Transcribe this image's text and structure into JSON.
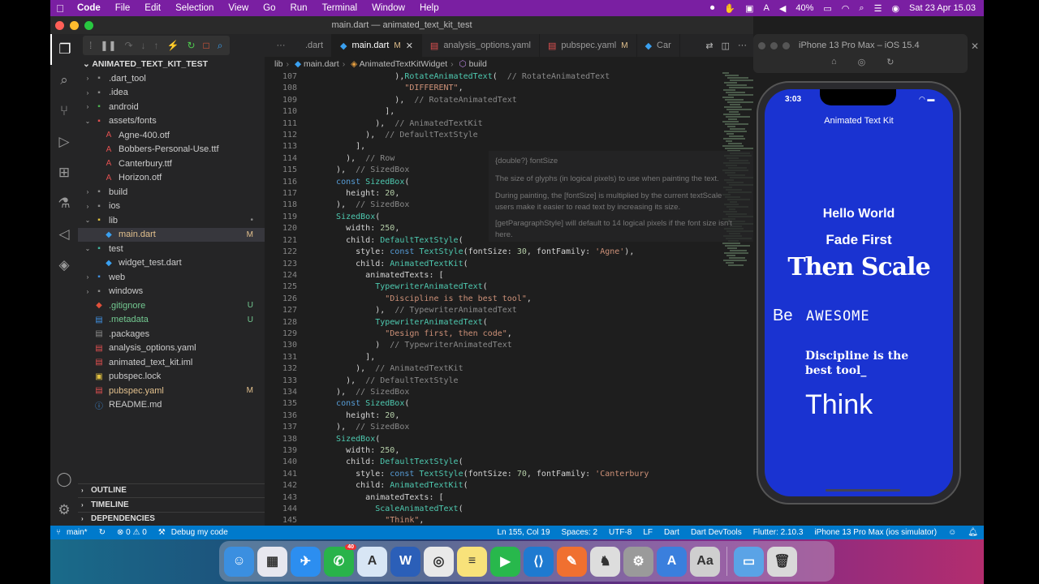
{
  "menubar": {
    "app": "Code",
    "items": [
      "File",
      "Edit",
      "Selection",
      "View",
      "Go",
      "Run",
      "Terminal",
      "Window",
      "Help"
    ],
    "battery": "40%",
    "datetime": "Sat 23 Apr  15.03"
  },
  "window": {
    "title": "main.dart — animated_text_kit_test"
  },
  "sidebar": {
    "root": "ANIMATED_TEXT_KIT_TEST",
    "items": [
      {
        "label": ".dart_tool",
        "indent": 1,
        "type": "folder",
        "chev": "›",
        "badge": ""
      },
      {
        "label": ".idea",
        "indent": 1,
        "type": "folder",
        "chev": "›",
        "badge": ""
      },
      {
        "label": "android",
        "indent": 1,
        "type": "folder-green",
        "chev": "›",
        "badge": ""
      },
      {
        "label": "assets/fonts",
        "indent": 1,
        "type": "folder-red",
        "chev": "⌄",
        "badge": ""
      },
      {
        "label": "Agne-400.otf",
        "indent": 2,
        "type": "font",
        "chev": "",
        "badge": ""
      },
      {
        "label": "Bobbers-Personal-Use.ttf",
        "indent": 2,
        "type": "font",
        "chev": "",
        "badge": ""
      },
      {
        "label": "Canterbury.ttf",
        "indent": 2,
        "type": "font",
        "chev": "",
        "badge": ""
      },
      {
        "label": "Horizon.otf",
        "indent": 2,
        "type": "font",
        "chev": "",
        "badge": ""
      },
      {
        "label": "build",
        "indent": 1,
        "type": "folder",
        "chev": "›",
        "badge": ""
      },
      {
        "label": "ios",
        "indent": 1,
        "type": "folder",
        "chev": "›",
        "badge": ""
      },
      {
        "label": "lib",
        "indent": 1,
        "type": "folder-yellow",
        "chev": "⌄",
        "badge": "•"
      },
      {
        "label": "main.dart",
        "indent": 2,
        "type": "dart",
        "chev": "",
        "badge": "M",
        "selected": true
      },
      {
        "label": "test",
        "indent": 1,
        "type": "folder-teal",
        "chev": "⌄",
        "badge": ""
      },
      {
        "label": "widget_test.dart",
        "indent": 2,
        "type": "dart",
        "chev": "",
        "badge": ""
      },
      {
        "label": "web",
        "indent": 1,
        "type": "folder-blue",
        "chev": "›",
        "badge": ""
      },
      {
        "label": "windows",
        "indent": 1,
        "type": "folder",
        "chev": "›",
        "badge": ""
      },
      {
        "label": ".gitignore",
        "indent": 1,
        "type": "git",
        "chev": "",
        "badge": "U"
      },
      {
        "label": ".metadata",
        "indent": 1,
        "type": "file-blue",
        "chev": "",
        "badge": "U"
      },
      {
        "label": ".packages",
        "indent": 1,
        "type": "file",
        "chev": "",
        "badge": ""
      },
      {
        "label": "analysis_options.yaml",
        "indent": 1,
        "type": "yaml",
        "chev": "",
        "badge": ""
      },
      {
        "label": "animated_text_kit.iml",
        "indent": 1,
        "type": "iml",
        "chev": "",
        "badge": ""
      },
      {
        "label": "pubspec.lock",
        "indent": 1,
        "type": "lock",
        "chev": "",
        "badge": ""
      },
      {
        "label": "pubspec.yaml",
        "indent": 1,
        "type": "yaml",
        "chev": "",
        "badge": "M"
      },
      {
        "label": "README.md",
        "indent": 1,
        "type": "md",
        "chev": "",
        "badge": ""
      }
    ],
    "sections": [
      "OUTLINE",
      "TIMELINE",
      "DEPENDENCIES"
    ]
  },
  "tabs": [
    {
      "label": ".dart",
      "modified": "",
      "active": false,
      "icon": ""
    },
    {
      "label": "main.dart",
      "modified": "M",
      "active": true,
      "icon": "dart"
    },
    {
      "label": "analysis_options.yaml",
      "modified": "",
      "active": false,
      "icon": "yaml"
    },
    {
      "label": "pubspec.yaml",
      "modified": "M",
      "active": false,
      "icon": "yaml"
    },
    {
      "label": "Car",
      "modified": "",
      "active": false,
      "icon": "dart"
    }
  ],
  "breadcrumb": [
    "lib",
    "main.dart",
    "AnimatedTextKitWidget",
    "build"
  ],
  "hover": {
    "sig": "{double?} fontSize",
    "lines": [
      "The size of glyphs (in logical pixels) to use when painting the text.",
      "During painting, the [fontSize] is multiplied by the current textScale",
      "users make it easier to read text by increasing its size.",
      "[getParagraphStyle] will default to 14 logical pixels if the font size isn't",
      "here."
    ]
  },
  "code_start": 107,
  "code": [
    [
      [
        16,
        ""
      ],
      [
        "p",
        "),"
      ],
      [
        "c",
        "RotateAnimatedText"
      ],
      [
        "p",
        "(  "
      ],
      [
        "cmt",
        "// RotateAnimatedText"
      ]
    ],
    [
      [
        17,
        ""
      ],
      [
        "s",
        "\"DIFFERENT\""
      ],
      [
        "p",
        ","
      ]
    ],
    [
      [
        16,
        ""
      ],
      [
        "p",
        "),  "
      ],
      [
        "cmt",
        "// RotateAnimatedText"
      ]
    ],
    [
      [
        15,
        ""
      ],
      [
        "p",
        "],"
      ]
    ],
    [
      [
        14,
        ""
      ],
      [
        "p",
        "),  "
      ],
      [
        "cmt",
        "// AnimatedTextKit"
      ]
    ],
    [
      [
        13,
        ""
      ],
      [
        "p",
        "),  "
      ],
      [
        "cmt",
        "// DefaultTextStyle"
      ]
    ],
    [
      [
        12,
        ""
      ],
      [
        "p",
        "],"
      ]
    ],
    [
      [
        11,
        ""
      ],
      [
        "p",
        "),  "
      ],
      [
        "cmt",
        "// Row"
      ]
    ],
    [
      [
        10,
        ""
      ],
      [
        "p",
        "),  "
      ],
      [
        "cmt",
        "// SizedBox"
      ]
    ],
    [
      [
        10,
        ""
      ],
      [
        "k",
        "const "
      ],
      [
        "c",
        "SizedBox"
      ],
      [
        "p",
        "("
      ]
    ],
    [
      [
        11,
        ""
      ],
      [
        "p",
        "height: "
      ],
      [
        "n",
        "20"
      ],
      [
        "p",
        ","
      ]
    ],
    [
      [
        10,
        ""
      ],
      [
        "p",
        "),  "
      ],
      [
        "cmt",
        "// SizedBox"
      ]
    ],
    [
      [
        10,
        ""
      ],
      [
        "c",
        "SizedBox"
      ],
      [
        "p",
        "("
      ]
    ],
    [
      [
        11,
        ""
      ],
      [
        "p",
        "width: "
      ],
      [
        "n",
        "250"
      ],
      [
        "p",
        ","
      ]
    ],
    [
      [
        11,
        ""
      ],
      [
        "p",
        "child: "
      ],
      [
        "c",
        "DefaultTextStyle"
      ],
      [
        "p",
        "("
      ]
    ],
    [
      [
        12,
        ""
      ],
      [
        "p",
        "style: "
      ],
      [
        "k",
        "const "
      ],
      [
        "c",
        "TextStyle"
      ],
      [
        "p",
        "(fontSize: "
      ],
      [
        "n",
        "30"
      ],
      [
        "p",
        ", fontFamily: "
      ],
      [
        "s",
        "'Agne'"
      ],
      [
        "p",
        "),"
      ]
    ],
    [
      [
        12,
        ""
      ],
      [
        "p",
        "child: "
      ],
      [
        "c",
        "AnimatedTextKit"
      ],
      [
        "p",
        "("
      ]
    ],
    [
      [
        13,
        ""
      ],
      [
        "p",
        "animatedTexts: ["
      ]
    ],
    [
      [
        14,
        ""
      ],
      [
        "c",
        "TypewriterAnimatedText"
      ],
      [
        "p",
        "("
      ]
    ],
    [
      [
        15,
        ""
      ],
      [
        "s",
        "\"Discipline is the best tool\""
      ],
      [
        "p",
        ","
      ]
    ],
    [
      [
        14,
        ""
      ],
      [
        "p",
        "),  "
      ],
      [
        "cmt",
        "// TypewriterAnimatedText"
      ]
    ],
    [
      [
        14,
        ""
      ],
      [
        "c",
        "TypewriterAnimatedText"
      ],
      [
        "p",
        "("
      ]
    ],
    [
      [
        15,
        ""
      ],
      [
        "s",
        "\"Design first, then code\""
      ],
      [
        "p",
        ","
      ]
    ],
    [
      [
        14,
        ""
      ],
      [
        "p",
        ")  "
      ],
      [
        "cmt",
        "// TypewriterAnimatedText"
      ]
    ],
    [
      [
        13,
        ""
      ],
      [
        "p",
        "],"
      ]
    ],
    [
      [
        12,
        ""
      ],
      [
        "p",
        "),  "
      ],
      [
        "cmt",
        "// AnimatedTextKit"
      ]
    ],
    [
      [
        11,
        ""
      ],
      [
        "p",
        "),  "
      ],
      [
        "cmt",
        "// DefaultTextStyle"
      ]
    ],
    [
      [
        10,
        ""
      ],
      [
        "p",
        "),  "
      ],
      [
        "cmt",
        "// SizedBox"
      ]
    ],
    [
      [
        10,
        ""
      ],
      [
        "k",
        "const "
      ],
      [
        "c",
        "SizedBox"
      ],
      [
        "p",
        "("
      ]
    ],
    [
      [
        11,
        ""
      ],
      [
        "p",
        "height: "
      ],
      [
        "n",
        "20"
      ],
      [
        "p",
        ","
      ]
    ],
    [
      [
        10,
        ""
      ],
      [
        "p",
        "),  "
      ],
      [
        "cmt",
        "// SizedBox"
      ]
    ],
    [
      [
        10,
        ""
      ],
      [
        "c",
        "SizedBox"
      ],
      [
        "p",
        "("
      ]
    ],
    [
      [
        11,
        ""
      ],
      [
        "p",
        "width: "
      ],
      [
        "n",
        "250"
      ],
      [
        "p",
        ","
      ]
    ],
    [
      [
        11,
        ""
      ],
      [
        "p",
        "child: "
      ],
      [
        "c",
        "DefaultTextStyle"
      ],
      [
        "p",
        "("
      ]
    ],
    [
      [
        12,
        ""
      ],
      [
        "p",
        "style: "
      ],
      [
        "k",
        "const "
      ],
      [
        "c",
        "TextStyle"
      ],
      [
        "p",
        "(fontSize: "
      ],
      [
        "n",
        "70"
      ],
      [
        "p",
        ", fontFamily: "
      ],
      [
        "s",
        "'Canterbury"
      ]
    ],
    [
      [
        12,
        ""
      ],
      [
        "p",
        "child: "
      ],
      [
        "c",
        "AnimatedTextKit"
      ],
      [
        "p",
        "("
      ]
    ],
    [
      [
        13,
        ""
      ],
      [
        "p",
        "animatedTexts: ["
      ]
    ],
    [
      [
        14,
        ""
      ],
      [
        "c",
        "ScaleAnimatedText"
      ],
      [
        "p",
        "("
      ]
    ],
    [
      [
        15,
        ""
      ],
      [
        "s",
        "\"Think\""
      ],
      [
        "p",
        ","
      ]
    ]
  ],
  "simulator": {
    "title": "iPhone 13 Pro Max – iOS 15.4",
    "time": "3:03",
    "appbar": "Animated Text Kit",
    "hello": "Hello World",
    "fade": "Fade First",
    "scale": "Then Scale",
    "be": "Be",
    "awesome": "AWESOME",
    "discipline": "Discipline is the best tool_",
    "think": "Think"
  },
  "statusbar": {
    "branch": "main*",
    "errors": "⊗ 0 ⚠ 0",
    "debug": "Debug my code",
    "position": "Ln 155, Col 19",
    "spaces": "Spaces: 2",
    "encoding": "UTF-8",
    "eol": "LF",
    "lang": "Dart",
    "devtools": "Dart DevTools",
    "flutter": "Flutter: 2.10.3",
    "device": "iPhone 13 Pro Max (ios simulator)"
  },
  "dock": {
    "apps": [
      {
        "name": "finder",
        "glyph": "☺",
        "color": "#3b8fe0"
      },
      {
        "name": "launchpad",
        "glyph": "▦",
        "color": "#e7e7ef"
      },
      {
        "name": "safari",
        "glyph": "✈",
        "color": "#2c8ef0"
      },
      {
        "name": "whatsapp",
        "glyph": "✆",
        "color": "#29b34a",
        "badge": "40"
      },
      {
        "name": "ichat",
        "glyph": "A",
        "color": "#d8e6f5"
      },
      {
        "name": "word",
        "glyph": "W",
        "color": "#2b5fb8"
      },
      {
        "name": "chrome",
        "glyph": "◎",
        "color": "#e9e9e9"
      },
      {
        "name": "notes",
        "glyph": "≡",
        "color": "#f8e27a"
      },
      {
        "name": "facetime",
        "glyph": "▶",
        "color": "#28b84c"
      },
      {
        "name": "vscode",
        "glyph": "⟨⟩",
        "color": "#1f7ad0"
      },
      {
        "name": "postman",
        "glyph": "✎",
        "color": "#f07030"
      },
      {
        "name": "sequel",
        "glyph": "♞",
        "color": "#dddddd"
      },
      {
        "name": "settings",
        "glyph": "⚙",
        "color": "#9a9a9a"
      },
      {
        "name": "simulator",
        "glyph": "A",
        "color": "#3a7fdd"
      },
      {
        "name": "fontbook",
        "glyph": "Aa",
        "color": "#cfcfcf"
      }
    ],
    "trailing": [
      {
        "name": "downloads",
        "glyph": "▭",
        "color": "#5aa3e6"
      },
      {
        "name": "trash",
        "glyph": "🗑",
        "color": "#d9d9d9"
      }
    ]
  }
}
